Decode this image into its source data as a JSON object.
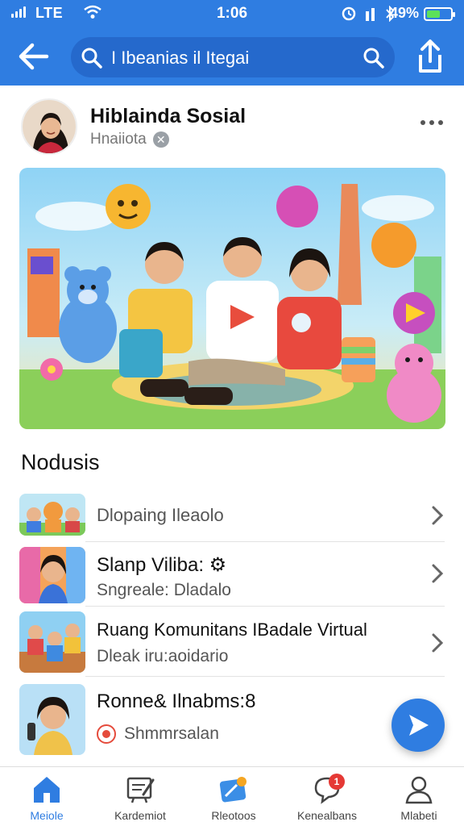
{
  "status_bar": {
    "carrier": "LTE",
    "time": "1:06",
    "battery": "49%"
  },
  "header": {
    "search_text": "I Ibeanias il Itegai"
  },
  "profile": {
    "name": "Hiblainda Sosial",
    "subtitle": "Hnaiiota"
  },
  "section": {
    "title": "Nodusis"
  },
  "list": [
    {
      "title": "Dlopaing Ileaolo",
      "subtitle": ""
    },
    {
      "title": "Slanp Viliba: ⚙",
      "subtitle": "Sngreale: Dladalo"
    },
    {
      "title": "Ruang Komunitans IBadale Virtual",
      "subtitle": "Dleak iru:aoidario"
    },
    {
      "title": "Ronne& Ilnabms:8",
      "subtitle": "Shmmrsalan"
    }
  ],
  "tabs": [
    {
      "label": "Meiole",
      "icon": "home-icon",
      "active": true,
      "badge": ""
    },
    {
      "label": "Kardemiot",
      "icon": "edit-board-icon",
      "active": false,
      "badge": ""
    },
    {
      "label": "Rleotoos",
      "icon": "media-icon",
      "active": false,
      "badge": ""
    },
    {
      "label": "Kenealbans",
      "icon": "chat-icon",
      "active": false,
      "badge": "1"
    },
    {
      "label": "Mlabeti",
      "icon": "profile-icon",
      "active": false,
      "badge": ""
    }
  ],
  "colors": {
    "accent": "#2f7de1",
    "header_bg": "#2f7de1",
    "badge": "#e53935",
    "battery_fill": "#5ce15a"
  }
}
